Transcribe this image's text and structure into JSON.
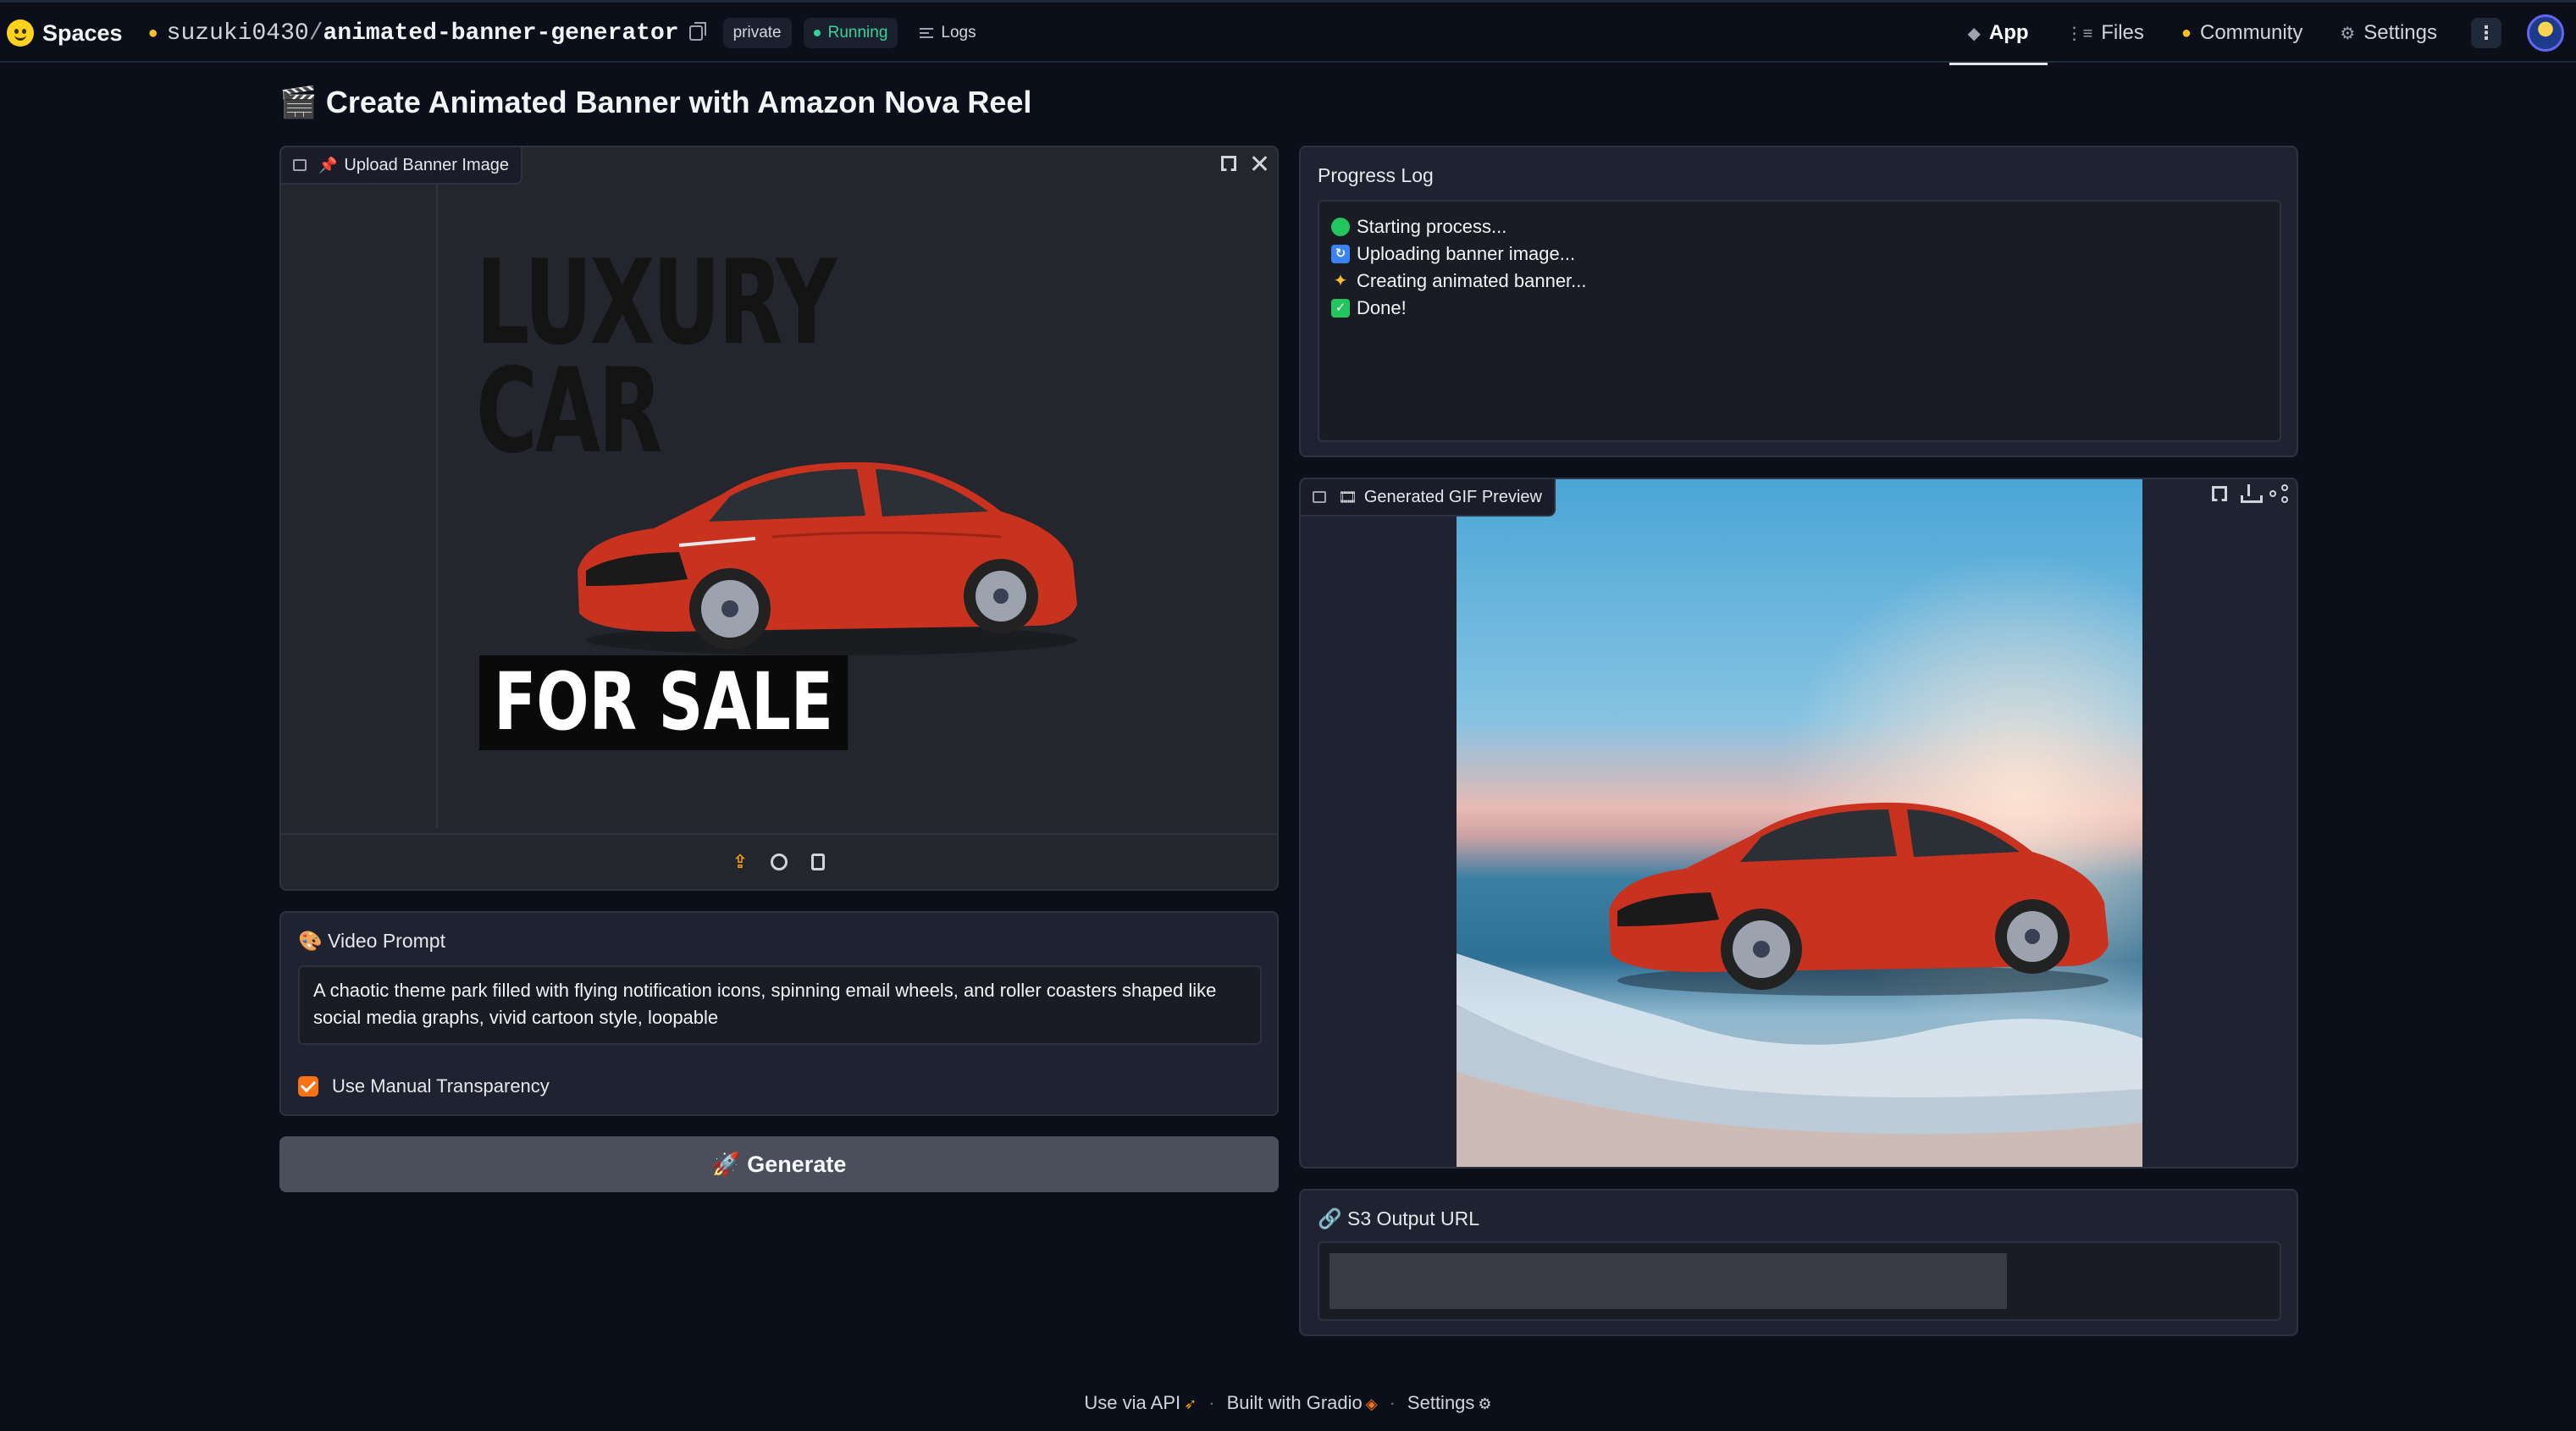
{
  "header": {
    "brand": "Spaces",
    "owner": "suzuki0430",
    "separator": "/",
    "repo": "animated-banner-generator",
    "visibility": "private",
    "status": "Running",
    "logs_label": "Logs",
    "nav": [
      {
        "label": "App",
        "icon": "cube-icon",
        "active": true
      },
      {
        "label": "Files",
        "icon": "files-icon"
      },
      {
        "label": "Community",
        "icon": "community-icon"
      },
      {
        "label": "Settings",
        "icon": "gear-icon"
      }
    ]
  },
  "page": {
    "title": "Create Animated Banner with Amazon Nova Reel",
    "title_emoji": "🎬"
  },
  "upload": {
    "label": "Upload Banner Image",
    "label_emoji": "📌",
    "banner_text_1": "LUXURY",
    "banner_text_2": "CAR",
    "banner_text_3": "FOR SALE"
  },
  "prompt": {
    "label": "Video Prompt",
    "label_emoji": "🎨",
    "value": "A chaotic theme park filled with flying notification icons, spinning email wheels, and roller coasters shaped like social media graphs, vivid cartoon style, loopable",
    "checkbox_label": "Use Manual Transparency",
    "checkbox_checked": true
  },
  "generate": {
    "label": "Generate",
    "emoji": "🚀"
  },
  "progress": {
    "label": "Progress Log",
    "lines": [
      {
        "icon": "green-circle-icon",
        "text": "Starting process..."
      },
      {
        "icon": "refresh-icon",
        "text": "Uploading banner image..."
      },
      {
        "icon": "sparkles-icon",
        "text": "Creating animated banner..."
      },
      {
        "icon": "check-icon",
        "text": "Done!"
      }
    ]
  },
  "preview": {
    "label": "Generated GIF Preview",
    "label_emoji": "🎞"
  },
  "s3": {
    "label": "S3 Output URL",
    "label_emoji": "🔗",
    "value": ""
  },
  "footer": {
    "api": "Use via API",
    "built": "Built with Gradio",
    "settings": "Settings",
    "dot": "·"
  },
  "colors": {
    "background": "#0b0f19",
    "panel": "#1f2230",
    "accent": "#f97316",
    "running": "#34d399",
    "car_red": "#c8321f"
  }
}
